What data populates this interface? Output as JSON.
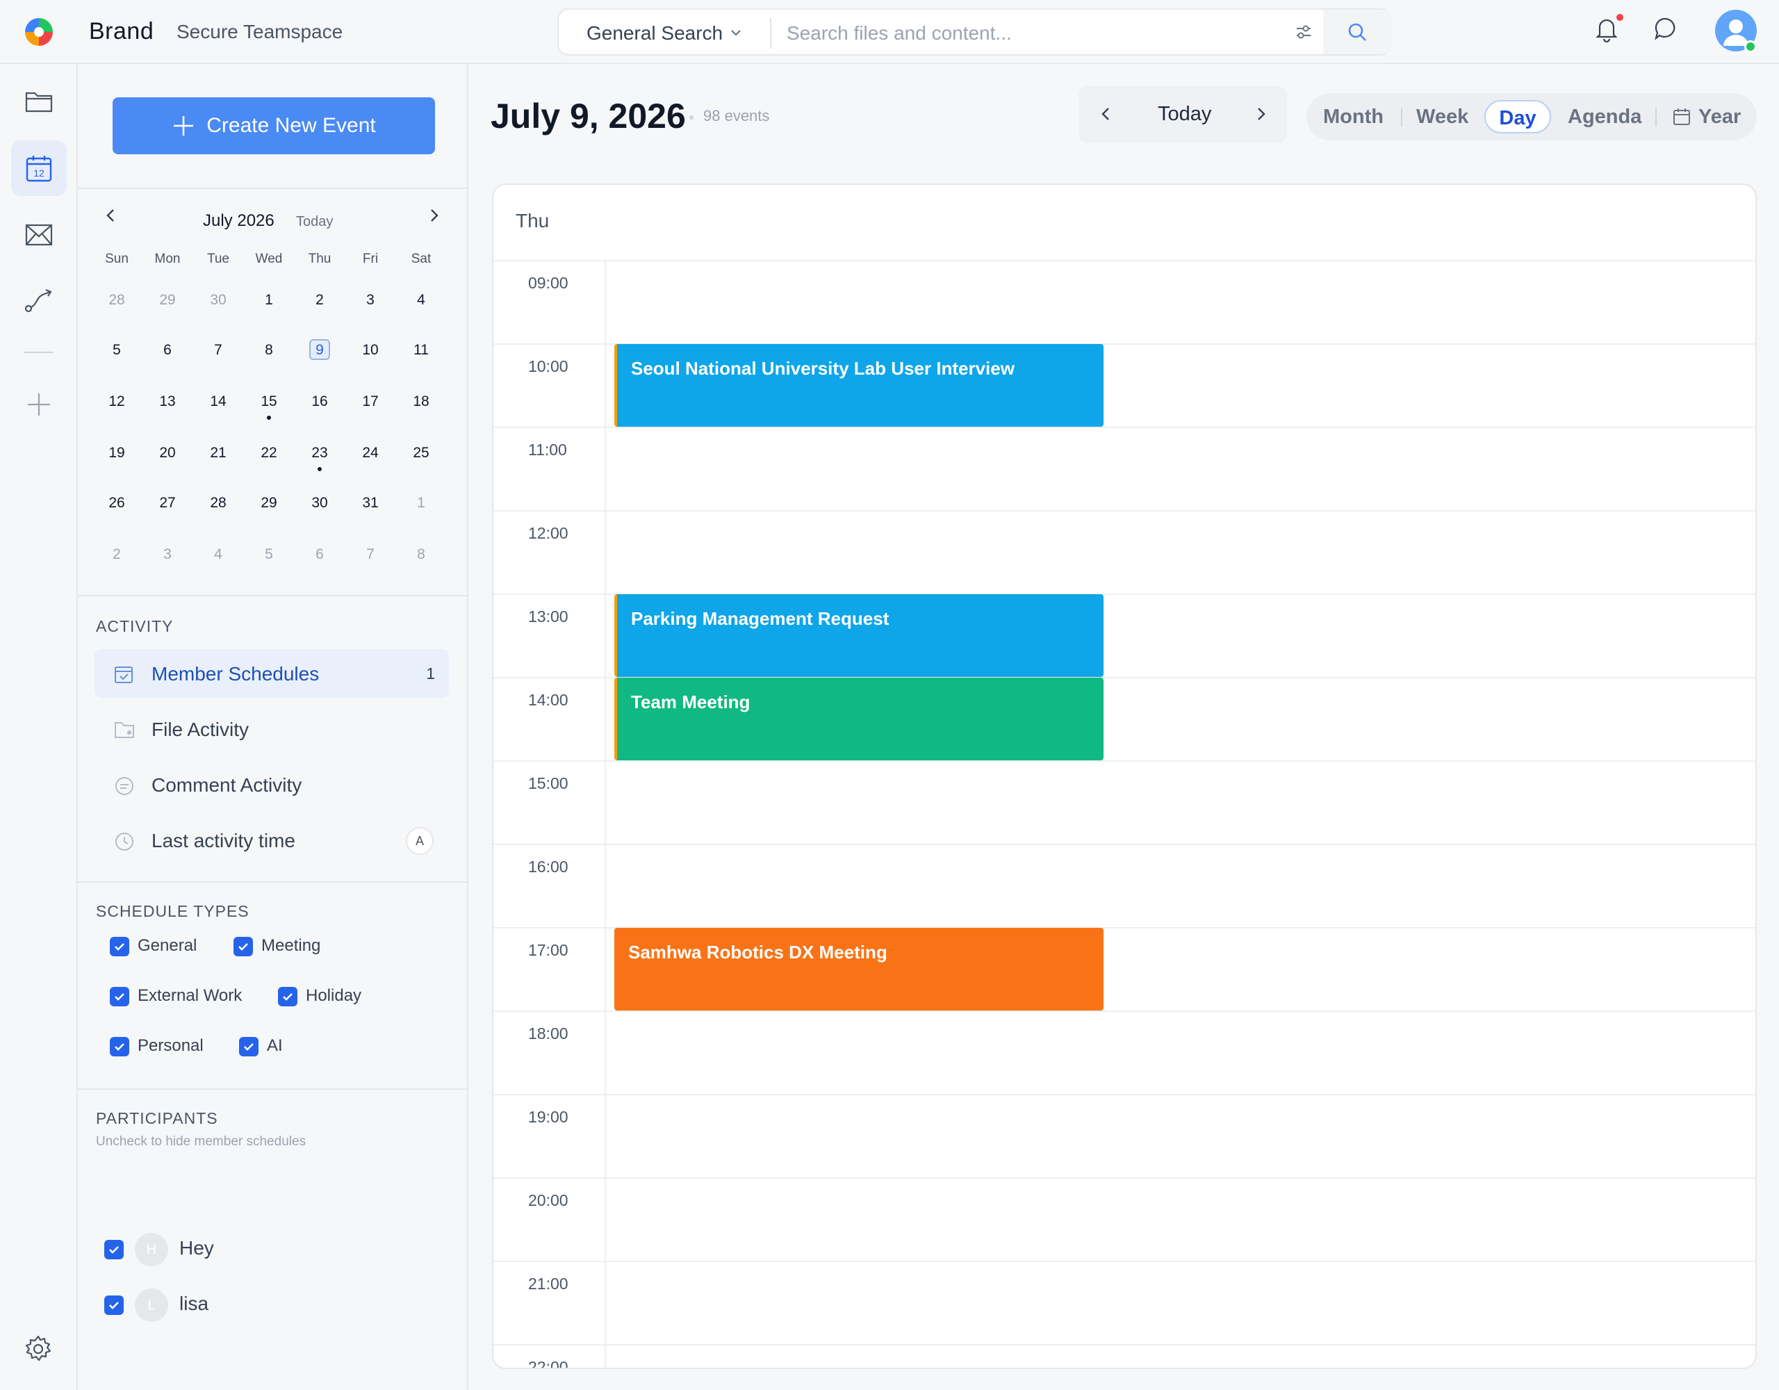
{
  "header": {
    "brand": "Brand",
    "workspace": "Secure Teamspace",
    "search_scope": "General Search",
    "search_placeholder": "Search files and content..."
  },
  "create_button": "Create New Event",
  "mini_calendar": {
    "month_label": "July 2026",
    "today_label": "Today",
    "weekdays": [
      "Sun",
      "Mon",
      "Tue",
      "Wed",
      "Thu",
      "Fri",
      "Sat"
    ],
    "weeks": [
      [
        "28",
        "29",
        "30",
        "1",
        "2",
        "3",
        "4"
      ],
      [
        "5",
        "6",
        "7",
        "8",
        "9",
        "10",
        "11"
      ],
      [
        "12",
        "13",
        "14",
        "15",
        "16",
        "17",
        "18"
      ],
      [
        "19",
        "20",
        "21",
        "22",
        "23",
        "24",
        "25"
      ],
      [
        "26",
        "27",
        "28",
        "29",
        "30",
        "31",
        "1"
      ],
      [
        "2",
        "3",
        "4",
        "5",
        "6",
        "7",
        "8"
      ]
    ],
    "selected_day": "9"
  },
  "activity": {
    "heading": "ACTIVITY",
    "items": [
      {
        "label": "Member Schedules",
        "count": "1"
      },
      {
        "label": "File Activity"
      },
      {
        "label": "Comment Activity"
      },
      {
        "label": "Last activity time",
        "badge": "A"
      }
    ]
  },
  "schedule_types": {
    "heading": "SCHEDULE TYPES",
    "items": [
      "General",
      "Meeting",
      "External Work",
      "Holiday",
      "Personal",
      "AI"
    ]
  },
  "participants": {
    "heading": "PARTICIPANTS",
    "subtitle": "Uncheck to hide member schedules",
    "people": [
      {
        "initial": "H",
        "name": "Hey"
      },
      {
        "initial": "L",
        "name": "lisa"
      }
    ]
  },
  "main": {
    "date_title": "July 9, 2026",
    "event_count": "98 events",
    "today_button": "Today",
    "views": [
      "Month",
      "Week",
      "Day",
      "Agenda",
      "Year"
    ],
    "active_view": "Day",
    "day_header": "Thu",
    "hours": [
      "09:00",
      "10:00",
      "11:00",
      "12:00",
      "13:00",
      "14:00",
      "15:00",
      "16:00",
      "17:00",
      "18:00",
      "19:00",
      "20:00",
      "21:00",
      "22:00"
    ],
    "events": [
      {
        "title": "Seoul National University Lab User Interview",
        "start": "10:00",
        "end": "11:00",
        "color": "#0ea5e9"
      },
      {
        "title": "Parking Management Request",
        "start": "13:00",
        "end": "14:00",
        "color": "#0ea5e9"
      },
      {
        "title": "Team Meeting",
        "start": "14:00",
        "end": "15:00",
        "color": "#10b981"
      },
      {
        "title": "Samhwa Robotics DX Meeting",
        "start": "17:00",
        "end": "18:00",
        "color": "#f97316"
      }
    ]
  },
  "colors": {
    "accent": "#4a8af4",
    "selected": "#1d4ed8"
  }
}
